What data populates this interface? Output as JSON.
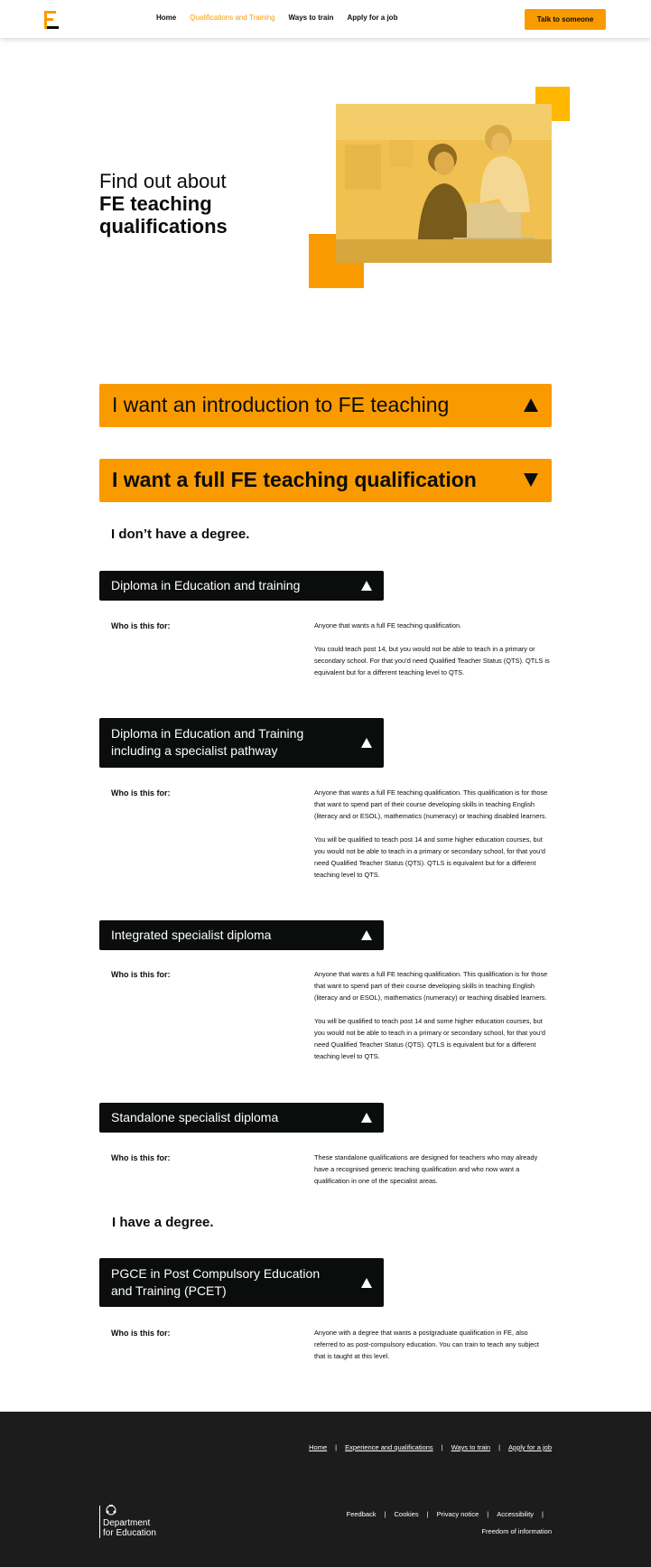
{
  "header": {
    "nav": [
      "Home",
      "Qualifications and Training",
      "Ways to train",
      "Apply for a job"
    ],
    "active_nav": "Qualifications and Training",
    "cta": "Talk to someone"
  },
  "hero": {
    "title_light": "Find out about",
    "title_bold_1": "FE teaching",
    "title_bold_2": "qualifications"
  },
  "accordions": {
    "intro": "I want an introduction to FE teaching",
    "full": "I want a full FE teaching qualification"
  },
  "no_degree": "I don’t have a degree.",
  "have_degree": "I have a degree.",
  "who_label": "Who is this for:",
  "quals": [
    {
      "title": "Diploma in Education and training",
      "para1": "Anyone that wants a full FE teaching qualification.",
      "para2": "You could teach post 14, but you would not be able to teach in a primary or secondary school. For that you’d need Qualified Teacher Status (QTS). QTLS is equivalent but for a different teaching level to QTS."
    },
    {
      "title": "Diploma in Education and Training including a specialist pathway",
      "para1": "Anyone that wants a full FE teaching qualification. This qualification is for those that want to spend part of their course developing skills in teaching English (literacy and or ESOL), mathematics (numeracy) or teaching disabled learners.",
      "para2": "You will be qualified to teach post 14 and some higher education courses, but you would not be able to teach in a primary or secondary school, for that you’d need Qualified Teacher Status (QTS). QTLS is equivalent but for a different teaching level to QTS."
    },
    {
      "title": "Integrated specialist diploma",
      "para1": "Anyone that wants a full FE teaching qualification. This qualification is for those that want to spend part of their course developing skills in teaching English (literacy and or ESOL), mathematics (numeracy) or teaching disabled learners.",
      "para2": "You will be qualified to teach post 14 and some higher education courses, but you would not be able to teach in a primary or secondary school, for that you’d need Qualified Teacher Status (QTS). QTLS is equivalent but for a different teaching level to QTS."
    },
    {
      "title": "Standalone specialist diploma",
      "para1": "These standalone qualifications are designed for teachers who may already have a recognised generic teaching qualification and who now want a qualification in one of the specialist areas."
    },
    {
      "title": "PGCE in Post Compulsory Education and Training (PCET)",
      "para1": "Anyone with a degree that wants a postgraduate qualification in FE, also referred to as post-compulsory education. You can train to teach any subject that is taught at this level."
    }
  ],
  "footer": {
    "links": [
      "Home",
      "Experience and qualifications",
      "Ways to train",
      "Apply for a job"
    ],
    "org_line1": "Department",
    "org_line2": "for Education",
    "meta": [
      "Feedback",
      "Cookies",
      "Privacy notice",
      "Accessibility"
    ],
    "meta2": "Freedom of information"
  }
}
